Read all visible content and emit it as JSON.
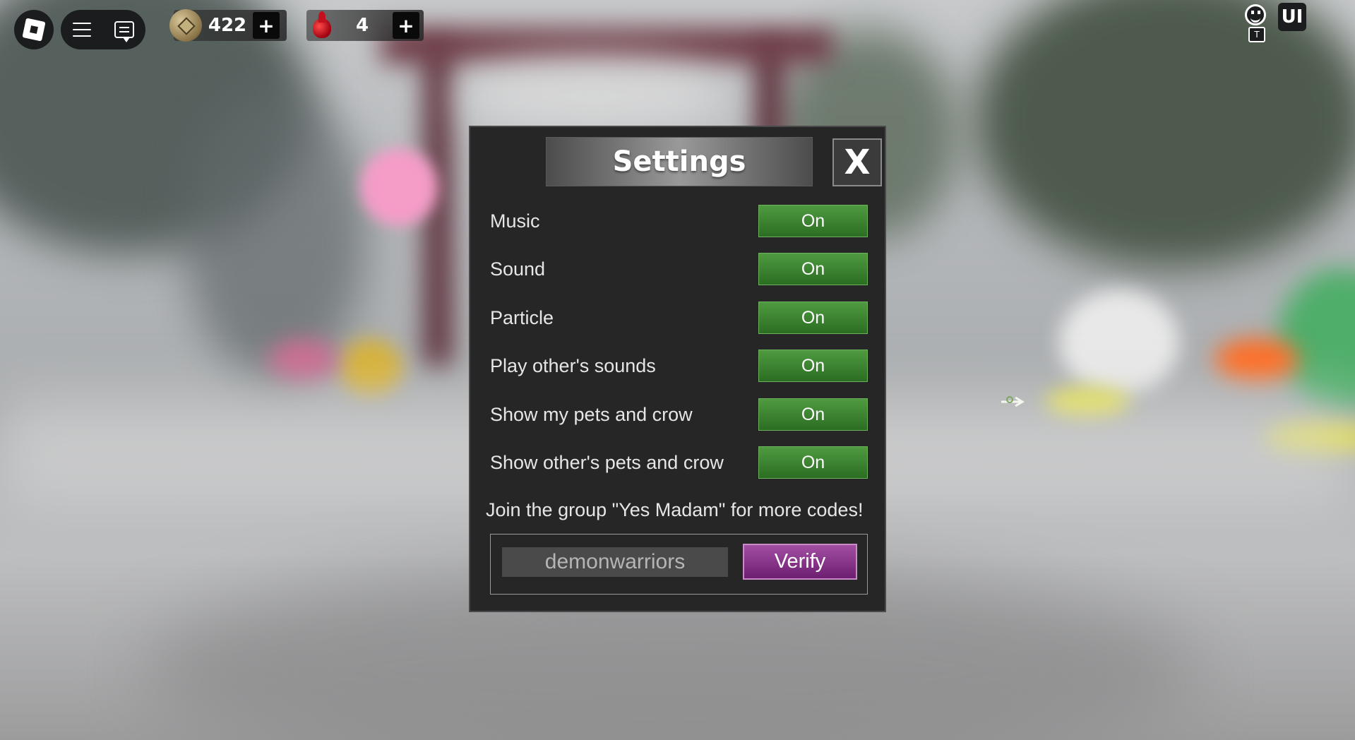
{
  "hud": {
    "coins": "422",
    "gems": "4",
    "coin_plus": "+",
    "gem_plus": "+",
    "emote_key": "T",
    "ui_toggle": "UI"
  },
  "settings": {
    "title": "Settings",
    "close_label": "X",
    "rows": [
      {
        "label": "Music",
        "state": "On"
      },
      {
        "label": "Sound",
        "state": "On"
      },
      {
        "label": "Particle",
        "state": "On"
      },
      {
        "label": "Play other's sounds",
        "state": "On"
      },
      {
        "label": "Show my pets and crow",
        "state": "On"
      },
      {
        "label": "Show other's pets and crow",
        "state": "On"
      }
    ],
    "promo_text": "Join the group \"Yes Madam\" for more codes!",
    "code_value": "demonwarriors",
    "verify_label": "Verify"
  },
  "colors": {
    "toggle_on": "#3f8a33",
    "verify": "#8e3a91",
    "panel_bg": "#262626"
  }
}
